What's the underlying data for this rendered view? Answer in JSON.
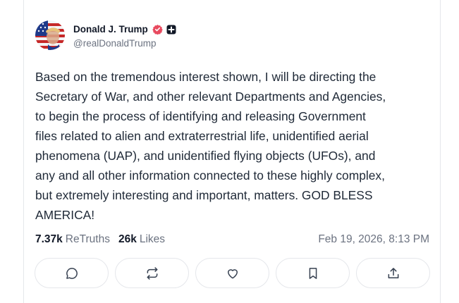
{
  "author": {
    "display_name": "Donald J. Trump",
    "handle": "@realDonaldTrump",
    "avatar_icon": "avatar-flag-portrait",
    "verified_color": "#e84a5f"
  },
  "post": {
    "text": "Based on the tremendous interest shown, I will be directing the\nSecretary of War, and other relevant Departments and Agencies,\nto begin the process of identifying and releasing Government\nfiles related to alien and extraterrestrial life, unidentified aerial\nphenomena (UAP), and unidentified flying objects (UFOs), and\nany and all other information connected to these highly complex,\nbut extremely interesting and important, matters. GOD BLESS\nAMERICA!"
  },
  "stats": {
    "retruths_count": "7.37k",
    "retruths_label": "ReTruths",
    "likes_count": "26k",
    "likes_label": "Likes",
    "timestamp": "Feb 19, 2026, 8:13 PM"
  },
  "actions": {
    "reply_icon": "reply-icon",
    "retruth_icon": "retruth-icon",
    "like_icon": "heart-icon",
    "bookmark_icon": "bookmark-icon",
    "share_icon": "share-icon"
  }
}
